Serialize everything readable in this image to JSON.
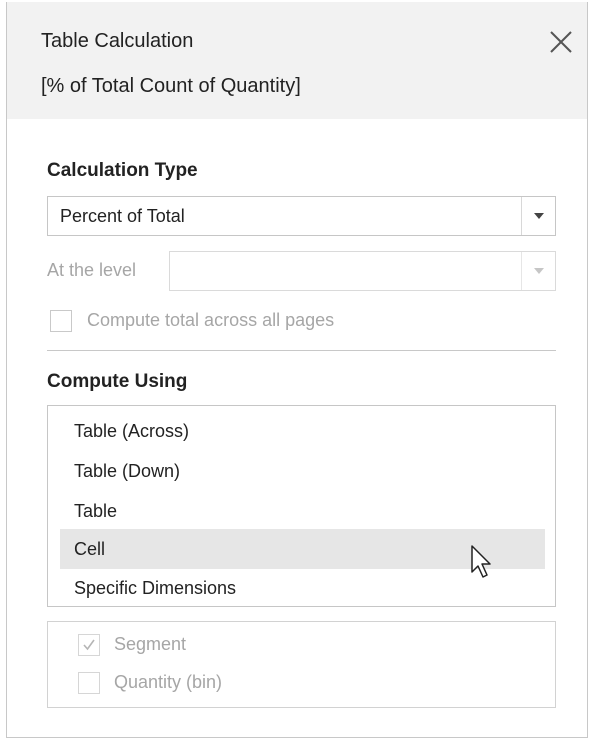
{
  "header": {
    "title": "Table Calculation",
    "subtitle": "[% of Total Count of Quantity]",
    "close_icon": "close-icon"
  },
  "calculation_type": {
    "label": "Calculation Type",
    "selected": "Percent of Total",
    "at_level_label": "At the level",
    "at_level_value": "",
    "compute_total_label": "Compute total across all pages",
    "compute_total_checked": false
  },
  "compute_using": {
    "label": "Compute Using",
    "options": [
      "Table (Across)",
      "Table (Down)",
      "Table",
      "Cell",
      "Specific Dimensions"
    ],
    "selected_index": 3,
    "dimensions": [
      {
        "label": "Segment",
        "checked": true
      },
      {
        "label": "Quantity (bin)",
        "checked": false
      }
    ]
  }
}
